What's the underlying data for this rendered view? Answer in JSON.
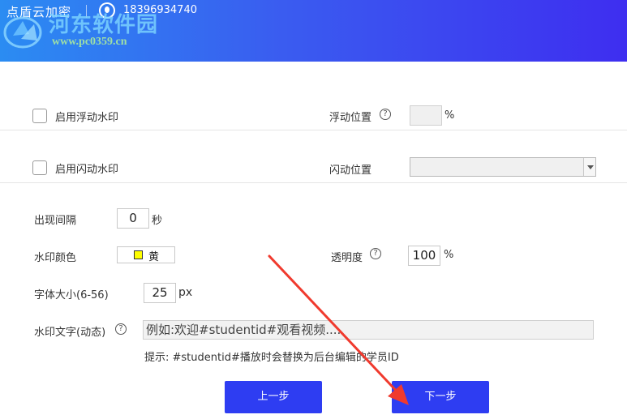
{
  "header": {
    "app_title": "点盾云加密",
    "phone": "18396934740",
    "watermark_site": "河东软件园",
    "watermark_url": "www.pc0359.cn"
  },
  "float_watermark": {
    "label": "启用浮动水印",
    "checked": false,
    "position_label": "浮动位置",
    "position_value": "",
    "position_unit": "%"
  },
  "flash_watermark": {
    "label": "启用闪动水印",
    "checked": false,
    "position_label": "闪动位置",
    "position_value": ""
  },
  "interval": {
    "label": "出现间隔",
    "value": "0",
    "unit": "秒"
  },
  "color": {
    "label": "水印颜色",
    "value": "黄",
    "swatch": "#ffff00"
  },
  "opacity": {
    "label": "透明度",
    "value": "100",
    "unit": "%"
  },
  "font_size": {
    "label": "字体大小(6-56)",
    "value": "25",
    "unit": "px"
  },
  "text": {
    "label": "水印文字(动态)",
    "placeholder": "例如:欢迎#studentid#观看视频....",
    "hint": "提示: #studentid#播放时会替换为后台编辑的学员ID"
  },
  "buttons": {
    "prev": "上一步",
    "next": "下一步",
    "primary_color": "#2e3df2"
  },
  "annotation": {
    "arrow_color": "#f03a2e"
  }
}
